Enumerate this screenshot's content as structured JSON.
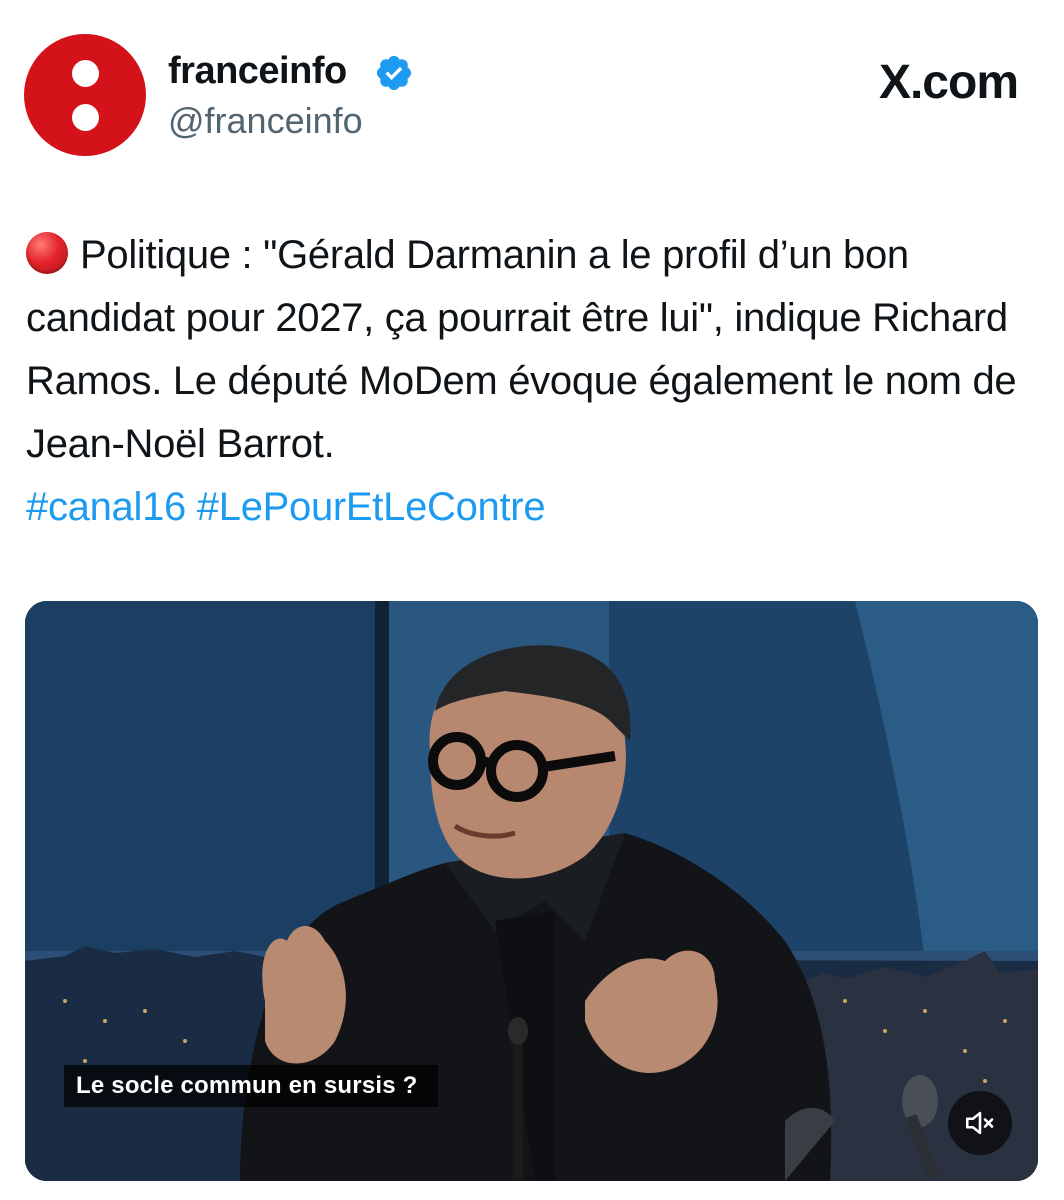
{
  "author": {
    "display_name": "franceinfo",
    "handle": "@franceinfo",
    "avatar_icon": "franceinfo-logo",
    "verified_icon": "verified-badge-icon"
  },
  "brand": {
    "site_label": "X.com"
  },
  "tweet": {
    "body": "Politique : \"Gérald Darmanin a le profil d’un bon candidat pour 2027, ça pourrait être lui\", indique Richard Ramos. Le député MoDem évoque également le nom de Jean-Noël Barrot.",
    "leading_emoji_icon": "red-circle-icon",
    "hashtags": [
      "#canal16",
      "#LePourEtLeContre"
    ]
  },
  "media": {
    "caption": "Le socle commun en sursis ?",
    "mute_icon": "speaker-muted-icon"
  },
  "colors": {
    "brand_red": "#d4121a",
    "link_blue": "#1d9bf0",
    "text": "#0f1419",
    "secondary_text": "#536471"
  }
}
